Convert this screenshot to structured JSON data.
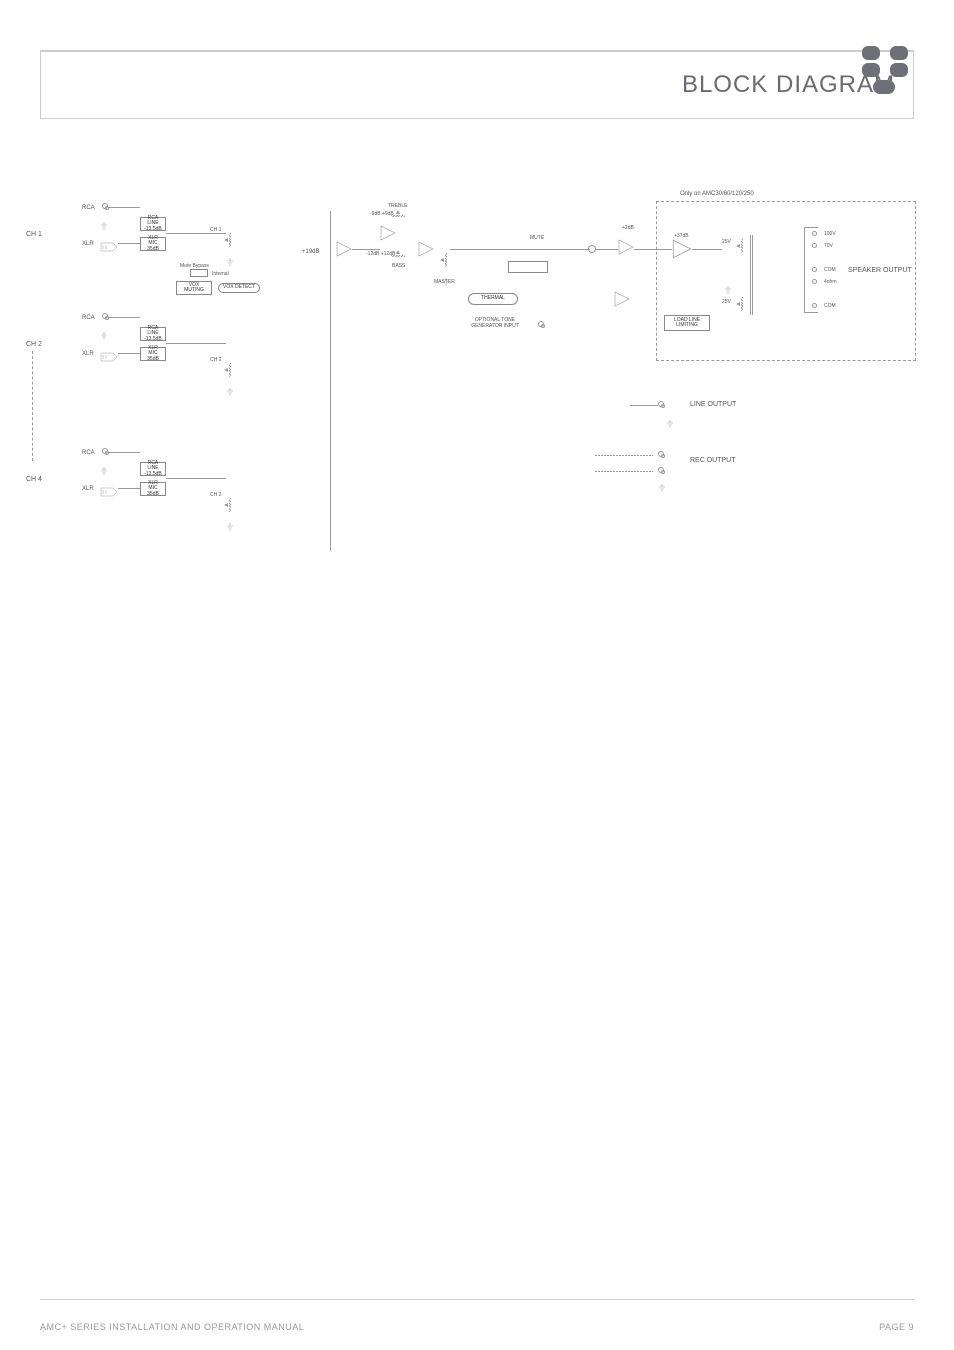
{
  "header": {
    "title": "BLOCK DIAGRAM"
  },
  "footer": {
    "left": "AMC+ SERIES INSTALLATION AND OPERATION MANUAL",
    "right": "PAGE 9"
  },
  "channels": {
    "ch1": {
      "label": "CH 1",
      "rca": "RCA",
      "xlr": "XLR"
    },
    "ch2": {
      "label": "CH 2",
      "rca": "RCA",
      "xlr": "XLR"
    },
    "ch4": {
      "label": "CH 4",
      "rca": "RCA",
      "xlr": "XLR"
    }
  },
  "switch_labels": {
    "rca_line": "RCA\nLINE\n-13.5dB",
    "xlr_mic": "XLR\nMIC\n35dB"
  },
  "ch_pots": {
    "ch1": "CH 1",
    "ch2": "CH 2",
    "ch4": "CH 2"
  },
  "mute_section": {
    "bypass": "Mute Bypass",
    "internal": "Internal",
    "vox": "VOX\nMUTING",
    "detect": "VOX DETECT"
  },
  "preamp_gain": "+19dB",
  "tone": {
    "treble": "TREBLE",
    "treble_range": "-9dB         +9dB",
    "bass": "BASS",
    "bass_range": "-12dB        +12dB",
    "master": "MASTER"
  },
  "mute": "MUTE",
  "thermal": "THERMAL",
  "tone_gen": "OPTIONAL TONE\nGENERATOR INPUT",
  "pre_power_gain": "+2dB",
  "power_section": {
    "note": "Only on AMC30/60/120/250",
    "gain": "+37dB",
    "tap1": "25V",
    "tap2": "25V",
    "limiting": "LOAD LINE\nLIMITING"
  },
  "outputs": {
    "speaker": "SPEAKER OUTPUT",
    "t100v": "100V",
    "t70v": "70V",
    "com1": "COM",
    "t4ohm": "4ohm",
    "com2": "COM",
    "line": "LINE OUTPUT",
    "rec": "REC OUTPUT"
  }
}
